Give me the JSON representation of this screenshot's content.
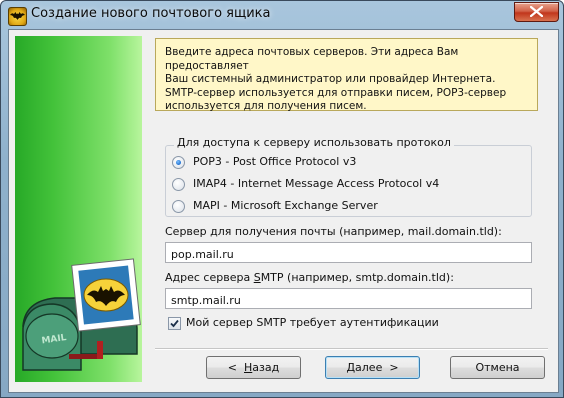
{
  "window": {
    "title": "Создание нового почтового ящика"
  },
  "info": {
    "lines": [
      "Введите адреса почтовых серверов. Эти адреса Вам предоставляет",
      "Ваш системный администратор или провайдер Интернета.",
      "SMTP-сервер используется для отправки писем, POP3-сервер",
      "используется для получения писем."
    ]
  },
  "protocol": {
    "caption": "Для доступа к серверу использовать протокол",
    "options": [
      {
        "label": "POP3 - Post Office Protocol v3",
        "checked": true
      },
      {
        "label": "IMAP4 - Internet Message Access Protocol v4",
        "checked": false
      },
      {
        "label": "MAPI - Microsoft Exchange Server",
        "checked": false
      }
    ]
  },
  "incoming": {
    "label": "Сервер для получения почты  (например, mail.domain.tld):",
    "value": "pop.mail.ru"
  },
  "smtp": {
    "label_before": "Адрес сервера ",
    "label_mnemonic": "S",
    "label_after": "MTP (например, smtp.domain.tld):",
    "value": "smtp.mail.ru"
  },
  "auth": {
    "label": "Мой сервер SMTP требует аутентификации",
    "checked": true
  },
  "buttons": {
    "back_arrow": "<",
    "back_mnemonic": "Н",
    "back_rest": "азад",
    "next_mnemonic": "Д",
    "next_rest": "алее",
    "next_arrow": ">",
    "cancel": "Отмена"
  },
  "icons": {
    "app": "bat-logo-icon",
    "close": "close-icon",
    "banner": "mailbox-illustration",
    "mailbox_lettering": "MAIL"
  },
  "colors": {
    "title_bar": "#8fb1cc",
    "banner_green": "#43c23a",
    "info_background": "#fff7c8",
    "close_red": "#c1361c"
  }
}
